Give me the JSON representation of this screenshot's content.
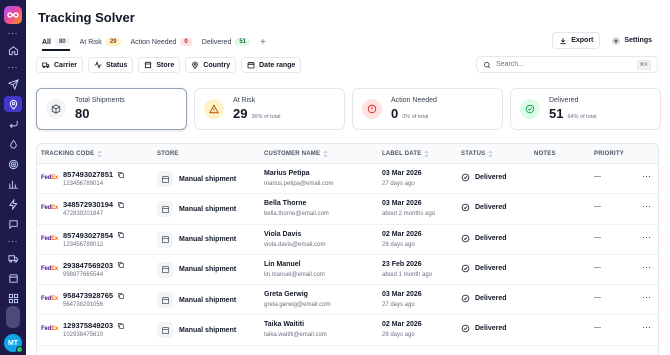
{
  "page": {
    "title": "Tracking Solver"
  },
  "sidebar": {
    "items": [
      {
        "icon": "home-icon"
      },
      {
        "icon": "send-icon"
      },
      {
        "icon": "location-pin-icon",
        "active": true
      },
      {
        "icon": "return-arrow-icon"
      },
      {
        "icon": "drop-icon"
      },
      {
        "icon": "target-icon"
      },
      {
        "icon": "bar-chart-icon"
      },
      {
        "icon": "bolt-icon"
      },
      {
        "icon": "chat-icon"
      },
      {
        "icon": "truck-icon"
      },
      {
        "icon": "store-icon"
      },
      {
        "icon": "apps-grid-icon"
      }
    ],
    "avatar_initials": "MT"
  },
  "tabs": [
    {
      "label": "All",
      "count": "80"
    },
    {
      "label": "At Risk",
      "count": "29"
    },
    {
      "label": "Action Needed",
      "count": "0"
    },
    {
      "label": "Delivered",
      "count": "51"
    }
  ],
  "tab_add": "+",
  "actions": {
    "export_label": "Export",
    "settings_label": "Settings"
  },
  "filters": [
    {
      "label": "Carrier",
      "icon": "truck-icon"
    },
    {
      "label": "Status",
      "icon": "activity-icon"
    },
    {
      "label": "Store",
      "icon": "store-icon"
    },
    {
      "label": "Country",
      "icon": "location-pin-icon"
    },
    {
      "label": "Date range",
      "icon": "calendar-icon"
    }
  ],
  "search": {
    "placeholder": "Search...",
    "shortcut": "⌘K"
  },
  "cards": [
    {
      "label": "Total Shipments",
      "value": "80",
      "sub": ""
    },
    {
      "label": "At Risk",
      "value": "29",
      "sub": "36% of total"
    },
    {
      "label": "Action Needed",
      "value": "0",
      "sub": "0% of total"
    },
    {
      "label": "Delivered",
      "value": "51",
      "sub": "64% of total"
    }
  ],
  "table": {
    "columns": [
      "TRACKING CODE",
      "STORE",
      "CUSTOMER NAME",
      "LABEL DATE",
      "STATUS",
      "NOTES",
      "PRIORITY"
    ],
    "carrier_fe": "Fed",
    "carrier_ex": "Ex",
    "rows": [
      {
        "code": "857493027851",
        "sub": "123456789014",
        "store": "Manual shipment",
        "name": "Marius Petipa",
        "email": "marius.petipa@email.com",
        "date": "03 Mar 2026",
        "ago": "27 days ago",
        "status": "Delivered",
        "priority": "—"
      },
      {
        "code": "348572930194",
        "sub": "472839201847",
        "store": "Manual shipment",
        "name": "Bella Thorne",
        "email": "bella.thorne@email.com",
        "date": "03 Mar 2026",
        "ago": "about 2 months ago",
        "status": "Delivered",
        "priority": "—"
      },
      {
        "code": "857493027854",
        "sub": "123456789012",
        "store": "Manual shipment",
        "name": "Viola Davis",
        "email": "viola.davis@email.com",
        "date": "02 Mar 2026",
        "ago": "28 days ago",
        "status": "Delivered",
        "priority": "—"
      },
      {
        "code": "293847569203",
        "sub": "998877665544",
        "store": "Manual shipment",
        "name": "Lin Manuel",
        "email": "lin.manuel@email.com",
        "date": "23 Feb 2026",
        "ago": "about 1 month ago",
        "status": "Delivered",
        "priority": "—"
      },
      {
        "code": "958473928765",
        "sub": "564738291056",
        "store": "Manual shipment",
        "name": "Greta Gerwig",
        "email": "greta.gerwig@email.com",
        "date": "03 Mar 2026",
        "ago": "27 days ago",
        "status": "Delivered",
        "priority": "—"
      },
      {
        "code": "129375849203",
        "sub": "102938475610",
        "store": "Manual shipment",
        "name": "Taika Waititi",
        "email": "taika.waititi@email.com",
        "date": "02 Mar 2026",
        "ago": "28 days ago",
        "status": "Delivered",
        "priority": "—"
      }
    ]
  }
}
